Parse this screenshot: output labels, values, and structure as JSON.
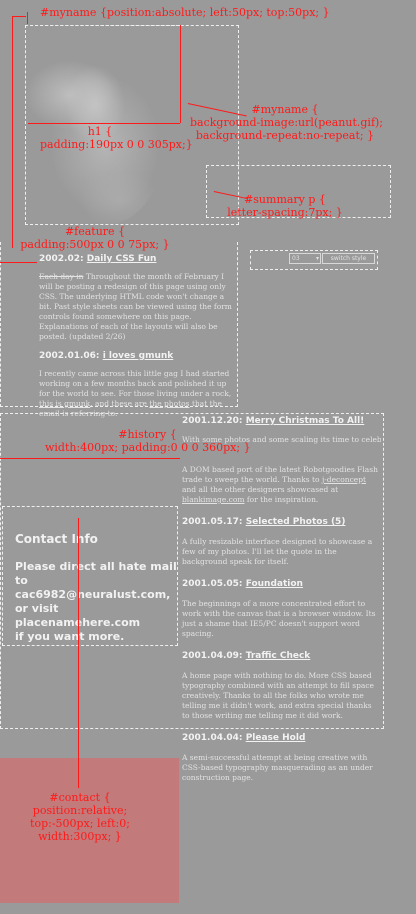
{
  "annotations": {
    "myname_pos": "#myname {position:absolute; left:50px; top:50px; }",
    "h1_line1": "h1 {",
    "h1_line2": "padding:190px 0 0 305px;}",
    "myname_bg1": "#myname {",
    "myname_bg2": "background-image:url(peanut.gif);",
    "myname_bg3": "background-repeat:no-repeat; }",
    "summary1": "#summary p {",
    "summary2": "letter-spacing:7px; }",
    "feature1": "#feature {",
    "feature2": "padding:500px 0 0 75px; }",
    "history1": "#history {",
    "history2": "width:400px; padding:0 0 0 360px; }",
    "contact1": "#contact {",
    "contact2": "position:relative;",
    "contact3": "top:-500px; left:0;",
    "contact4": "width:300px; }"
  },
  "style_switcher": {
    "selected": "03",
    "button": "switch style"
  },
  "feature": {
    "posts": [
      {
        "title_date": "2002.02:",
        "title_link": "Daily CSS Fun",
        "struck": "Each day in",
        "body": "Throughout the month of February I will be posting a redesign of this page using only CSS. The underlying HTML code won't change a bit. Past style sheets can be viewed using the form controls found somewhere on this page. Explanations of each of the layouts will also be posted. (updated 2/26)"
      },
      {
        "title_date": "2002.01.06:",
        "title_link": "i loves gmunk",
        "body_a": "I recently came across this little gag I had started working on a few months back and polished it up for the world to see. For those living under a rock,",
        "link1": "this is gmunk",
        "body_b": ", and these are",
        "link2": "the photos",
        "body_c": "that the email is referring to."
      }
    ]
  },
  "history": {
    "posts": [
      {
        "title_date": "2001.12.20:",
        "title_link": "Merry Christmas To All!",
        "body": "With some photos and some scaling its time to celebrate"
      },
      {
        "body_a": "A DOM based port of the latest Robotgoodies Flash trade to sweep the world. Thanks to",
        "link": "j-deconcept",
        "body_b": "and all the other designers showcased at",
        "link2": "blankimage.com",
        "body_c": "for the inspiration."
      },
      {
        "title_date": "2001.05.17:",
        "title_link": "Selected Photos (5)",
        "body": "A fully resizable interface designed to showcase a few of my photos. I'll let the quote in the background speak for itself."
      },
      {
        "title_date": "2001.05.05:",
        "title_link": "Foundation",
        "body": "The beginnings of a more concentrated effort to work with the canvas that is a browser window. Its just a shame that IE5/PC doesn't support word spacing."
      },
      {
        "title_date": "2001.04.09:",
        "title_link": "Traffic Check",
        "body": "A home page with nothing to do. More CSS based typography combined with an attempt to fill space creatively. Thanks to all the folks who wrote me telling me it didn't work, and extra special thanks to those writing me telling me it did work."
      },
      {
        "title_date": "2001.04.04:",
        "title_link": "Please Hold",
        "body": "A semi-successful attempt at being creative with CSS-based typography masquerading as an under construction page."
      }
    ]
  },
  "contact": {
    "title": "Contact Info",
    "line1": "Please direct all hate mail",
    "line2": "to cac6982@neuralust.com,",
    "line3": "or visit placenamehere.com",
    "line4": "if you want more."
  },
  "colors": {
    "background": "#9a9a9a",
    "annotation": "#ff1a1a",
    "contact_block": "#c27a7a"
  }
}
